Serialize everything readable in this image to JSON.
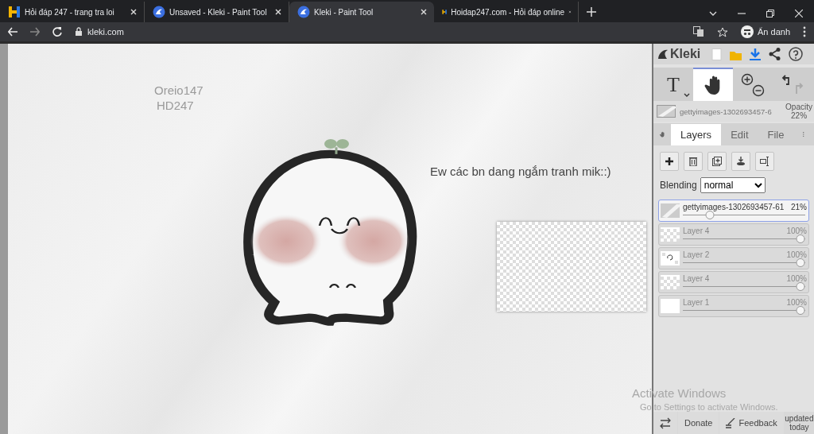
{
  "browser": {
    "tabs": [
      {
        "title": "Hỏi đáp 247 - trang tra loi",
        "kind": "hoidap",
        "selected": false
      },
      {
        "title": "Unsaved - Kleki - Paint Tool",
        "kind": "kleki",
        "selected": false
      },
      {
        "title": "Kleki - Paint Tool",
        "kind": "kleki",
        "selected": true
      },
      {
        "title": "Hoidap247.com - Hỏi đáp online",
        "kind": "hoidap",
        "selected": false
      }
    ],
    "url": "kleki.com",
    "profile": "Ẩn danh"
  },
  "canvas": {
    "texts": [
      {
        "text": "Oreio147",
        "kind": "stamp"
      },
      {
        "text": "HD247",
        "kind": "stamp"
      },
      {
        "text": "Ew các bn dang ngắm tranh mik::)",
        "kind": "caption"
      }
    ]
  },
  "panel": {
    "logo": "Kleki",
    "tools": [
      {
        "kind": "text",
        "label": "T",
        "selected": false
      },
      {
        "kind": "hand",
        "selected": true
      },
      {
        "kind": "zoom",
        "selected": false
      },
      {
        "kind": "undo",
        "selected": false
      }
    ],
    "current_layer": {
      "name": "gettyimages-1302693457-6",
      "opacity_label": "Opacity",
      "opacity": "22%"
    },
    "tabs": [
      {
        "label": "Layers",
        "selected": true
      },
      {
        "label": "Edit",
        "selected": false
      },
      {
        "label": "File",
        "selected": false
      }
    ],
    "blending": {
      "label": "Blending",
      "value": "normal"
    },
    "layers": [
      {
        "name": "gettyimages-1302693457-61",
        "opacity": "21%",
        "level": 0.23,
        "selected": true,
        "kind": "gradient"
      },
      {
        "name": "Layer 4",
        "opacity": "100%",
        "level": 1,
        "selected": false,
        "kind": "checker"
      },
      {
        "name": "Layer 2",
        "opacity": "100%",
        "level": 1,
        "selected": false,
        "kind": "mark"
      },
      {
        "name": "Layer 4",
        "opacity": "100%",
        "level": 1,
        "selected": false,
        "kind": "checker"
      },
      {
        "name": "Layer 1",
        "opacity": "100%",
        "level": 1,
        "selected": false,
        "kind": "white"
      }
    ],
    "footer": {
      "buttons": [
        {
          "kind": "icon"
        },
        {
          "kind": "text",
          "label": "Donate"
        },
        {
          "kind": "icon-text",
          "label": "Feedback"
        }
      ],
      "status": "updated today"
    }
  },
  "os_watermark": {
    "title": "Activate Windows",
    "subtitle": "Go to Settings to activate Windows."
  }
}
